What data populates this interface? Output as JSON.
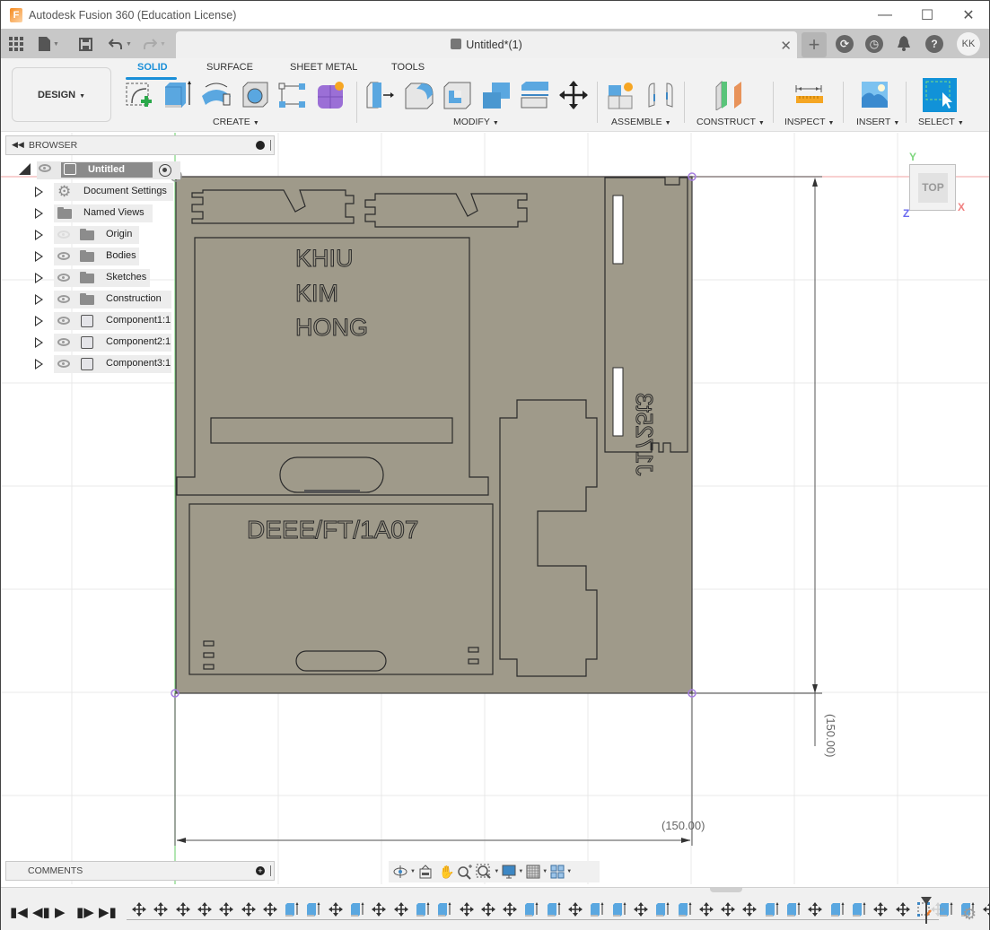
{
  "window": {
    "title": "Autodesk Fusion 360 (Education License)",
    "app_icon": "fusion-logo-icon",
    "controls": [
      "minimize",
      "maximize",
      "close"
    ]
  },
  "tabbar": {
    "document_tab": "Untitled*(1)",
    "avatar_initials": "KK",
    "icons": [
      "data-panel-grid-icon",
      "file-icon",
      "save-icon",
      "undo-icon",
      "redo-icon",
      "new-tab-plus-icon",
      "extensions-icon",
      "job-status-clock-icon",
      "notifications-bell-icon",
      "help-icon"
    ]
  },
  "ribbon": {
    "workspace": "DESIGN",
    "tabs": [
      {
        "label": "SOLID",
        "active": true
      },
      {
        "label": "SURFACE",
        "active": false
      },
      {
        "label": "SHEET METAL",
        "active": false
      },
      {
        "label": "TOOLS",
        "active": false
      }
    ],
    "groups": [
      {
        "label": "CREATE",
        "tools": [
          "create-sketch",
          "extrude",
          "revolve",
          "hole",
          "pattern",
          "create-form"
        ]
      },
      {
        "label": "MODIFY",
        "tools": [
          "press-pull",
          "fillet",
          "shell",
          "combine",
          "split-body",
          "move-copy"
        ]
      },
      {
        "label": "ASSEMBLE",
        "tools": [
          "new-component",
          "joint"
        ]
      },
      {
        "label": "CONSTRUCT",
        "tools": [
          "offset-plane"
        ]
      },
      {
        "label": "INSPECT",
        "tools": [
          "measure"
        ]
      },
      {
        "label": "INSERT",
        "tools": [
          "insert-canvas"
        ]
      },
      {
        "label": "SELECT",
        "tools": [
          "window-select"
        ]
      }
    ]
  },
  "browser": {
    "title": "BROWSER",
    "root": "Untitled",
    "items": [
      {
        "label": "Document Settings",
        "icon": "gear",
        "visible": null
      },
      {
        "label": "Named Views",
        "icon": "folder",
        "visible": null
      },
      {
        "label": "Origin",
        "icon": "folder",
        "visible": false
      },
      {
        "label": "Bodies",
        "icon": "folder",
        "visible": true
      },
      {
        "label": "Sketches",
        "icon": "folder",
        "visible": true
      },
      {
        "label": "Construction",
        "icon": "folder",
        "visible": true
      },
      {
        "label": "Component1:1",
        "icon": "component",
        "visible": true
      },
      {
        "label": "Component2:1",
        "icon": "component",
        "visible": true
      },
      {
        "label": "Component3:1",
        "icon": "component",
        "visible": true
      }
    ]
  },
  "viewport": {
    "viewcube_face": "TOP",
    "axes": {
      "x": "X",
      "y": "Y",
      "z": "Z"
    },
    "dimensions": {
      "horizontal": "(150.00)",
      "vertical": "(150.00)"
    },
    "engraved_text": {
      "name_lines": [
        "KHIU",
        "KIM",
        "HONG"
      ],
      "class_code": "DEEE/FT/1A07",
      "side_id": "J1725t3"
    },
    "colors": {
      "plate": "#9f9a8a",
      "edge": "#2e2e2e",
      "grid": "#e6e6e6",
      "x_axis": "#f0b0b0",
      "y_axis": "#7ed67e",
      "sketch_point": "#a67ee0",
      "accent": "#1a8fd8"
    }
  },
  "comments": {
    "title": "COMMENTS"
  },
  "nav_toolbar": [
    "orbit",
    "look-at",
    "pan",
    "zoom",
    "fit",
    "display-settings",
    "grid-settings",
    "viewports"
  ],
  "timeline": {
    "controls": [
      "go-to-start",
      "step-back",
      "play",
      "step-forward",
      "go-to-end"
    ],
    "features": [
      "move",
      "move",
      "move",
      "move",
      "move",
      "move",
      "move",
      "extrude",
      "extrude",
      "move",
      "extrude",
      "move",
      "move",
      "extrude",
      "extrude",
      "move",
      "move",
      "move",
      "extrude",
      "extrude",
      "move",
      "extrude",
      "extrude",
      "move",
      "extrude",
      "extrude",
      "move",
      "move",
      "move",
      "extrude",
      "extrude",
      "move",
      "extrude",
      "extrude",
      "move",
      "move",
      "sketch",
      "extrude",
      "extrude",
      "move",
      "sketch",
      "extrude",
      "move",
      "extrude",
      "move",
      "move",
      "extrude",
      "move"
    ]
  }
}
